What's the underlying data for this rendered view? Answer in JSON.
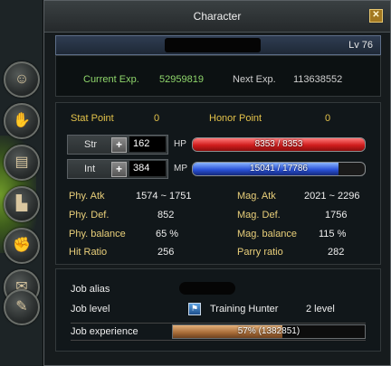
{
  "window": {
    "title": "Character"
  },
  "header": {
    "level": "Lv 76"
  },
  "exp": {
    "current_label": "Current Exp.",
    "current_value": "52959819",
    "next_label": "Next Exp.",
    "next_value": "113638552"
  },
  "points": {
    "stat_label": "Stat Point",
    "stat_value": "0",
    "honor_label": "Honor Point",
    "honor_value": "0"
  },
  "attributes": {
    "str": {
      "label": "Str",
      "value": "162",
      "bar_label": "HP",
      "bar_text": "8353 / 8353",
      "fill": 1.0
    },
    "int": {
      "label": "Int",
      "value": "384",
      "bar_label": "MP",
      "bar_text": "15041 / 17786",
      "fill": 0.8457
    }
  },
  "stats_left": [
    {
      "label": "Phy. Atk",
      "value": "1574 ~ 1751"
    },
    {
      "label": "Phy. Def.",
      "value": "852"
    },
    {
      "label": "Phy. balance",
      "value": "65 %"
    },
    {
      "label": "Hit Ratio",
      "value": "256"
    }
  ],
  "stats_right": [
    {
      "label": "Mag. Atk",
      "value": "2021 ~ 2296"
    },
    {
      "label": "Mag. Def.",
      "value": "1756"
    },
    {
      "label": "Mag. balance",
      "value": "115 %"
    },
    {
      "label": "Parry ratio",
      "value": "282"
    }
  ],
  "job": {
    "alias_label": "Job alias",
    "level_label": "Job level",
    "job_name": "Training Hunter",
    "job_level": "2 level",
    "exp_label": "Job experience",
    "exp_text": "57% (1382851)",
    "exp_fill": 0.57
  },
  "tabs": [
    {
      "icon": "character-portrait-icon"
    },
    {
      "icon": "gloves-icon"
    },
    {
      "icon": "book-icon"
    },
    {
      "icon": "boots-icon"
    },
    {
      "icon": "handshake-icon"
    },
    {
      "icon": "scroll-icon"
    },
    {
      "icon": "quill-icon"
    }
  ],
  "colors": {
    "stat_gold": "#e3c24a",
    "exp_green": "#8fd66b",
    "hp": "#d01c1c",
    "mp": "#2a52d8",
    "job_exp": "#a56a36"
  }
}
